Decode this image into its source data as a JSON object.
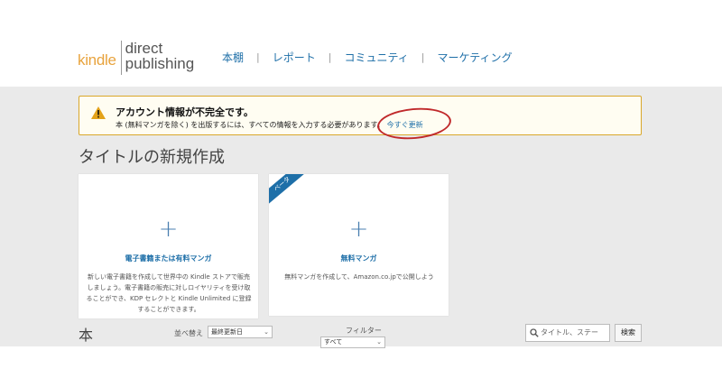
{
  "logo": {
    "kindle": "kindle",
    "line1": "direct",
    "line2": "publishing"
  },
  "nav": {
    "items": [
      "本棚",
      "レポート",
      "コミュニティ",
      "マーケティング"
    ],
    "separator": "|"
  },
  "alert": {
    "title": "アカウント情報が不完全です。",
    "text": "本 (無料マンガを除く) を出版するには、すべての情報を入力する必要があります。",
    "link": "今すぐ更新"
  },
  "section_title": "タイトルの新規作成",
  "cards": [
    {
      "plus": "+",
      "label": "電子書籍または有料マンガ",
      "desc": "新しい電子書籍を作成して世界中の Kindle ストアで販売しましょう。電子書籍の販売に対しロイヤリティを受け取ることができ、KDP セレクトと Kindle Unlimited に登録することができます。"
    },
    {
      "plus": "+",
      "label": "無料マンガ",
      "desc": "無料マンガを作成して、Amazon.co.jpで公開しよう",
      "ribbon": "ベータ"
    }
  ],
  "books": {
    "heading": "本",
    "sort_label": "並べ替え",
    "sort_value": "最終更新日",
    "filter_label": "フィルター",
    "filter_value": "すべて",
    "search_placeholder": "タイトル、ステー",
    "search_button": "検索"
  },
  "colors": {
    "accent": "#1e6fa8",
    "kindle_orange": "#e8a33d",
    "warning": "#d9a72a",
    "annotation": "#c0292b"
  }
}
